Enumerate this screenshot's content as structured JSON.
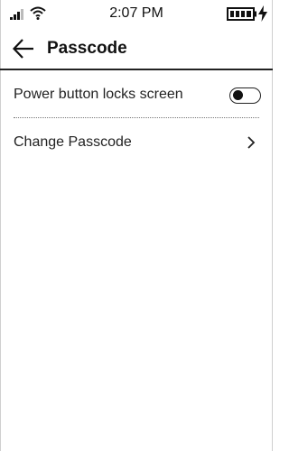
{
  "status_bar": {
    "time": "2:07 PM",
    "icons": [
      "signal-icon",
      "wifi-icon",
      "battery-icon",
      "charging-bolt-icon"
    ]
  },
  "header": {
    "back_icon": "arrow-left-icon",
    "title": "Passcode"
  },
  "settings": [
    {
      "label": "Power button locks screen",
      "control": "toggle",
      "enabled": false
    },
    {
      "label": "Change Passcode",
      "control": "chevron-right-icon"
    }
  ]
}
